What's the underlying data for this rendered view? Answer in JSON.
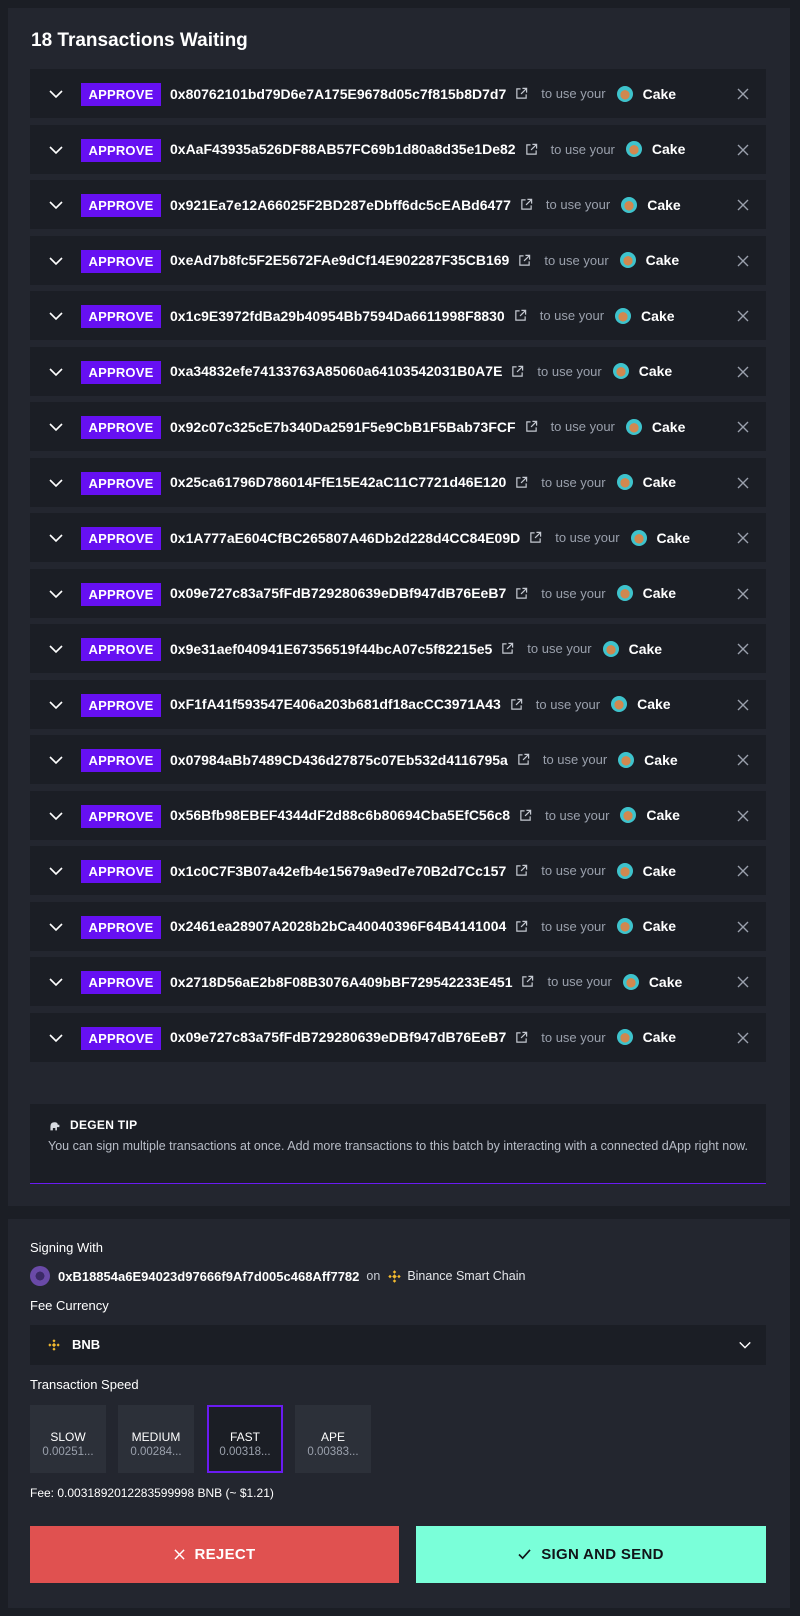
{
  "header": {
    "title": "18 Transactions Waiting"
  },
  "transactions": [
    {
      "action": "APPROVE",
      "address": "0x80762101bd79D6e7A175E9678d05c7f815b8D7d7",
      "use_text": "to use your",
      "token": "Cake"
    },
    {
      "action": "APPROVE",
      "address": "0xAaF43935a526DF88AB57FC69b1d80a8d35e1De82",
      "use_text": "to use your",
      "token": "Cake"
    },
    {
      "action": "APPROVE",
      "address": "0x921Ea7e12A66025F2BD287eDbff6dc5cEABd6477",
      "use_text": "to use your",
      "token": "Cake"
    },
    {
      "action": "APPROVE",
      "address": "0xeAd7b8fc5F2E5672FAe9dCf14E902287F35CB169",
      "use_text": "to use your",
      "token": "Cake"
    },
    {
      "action": "APPROVE",
      "address": "0x1c9E3972fdBa29b40954Bb7594Da6611998F8830",
      "use_text": "to use your",
      "token": "Cake"
    },
    {
      "action": "APPROVE",
      "address": "0xa34832efe74133763A85060a64103542031B0A7E",
      "use_text": "to use your",
      "token": "Cake"
    },
    {
      "action": "APPROVE",
      "address": "0x92c07c325cE7b340Da2591F5e9CbB1F5Bab73FCF",
      "use_text": "to use your",
      "token": "Cake"
    },
    {
      "action": "APPROVE",
      "address": "0x25ca61796D786014FfE15E42aC11C7721d46E120",
      "use_text": "to use your",
      "token": "Cake"
    },
    {
      "action": "APPROVE",
      "address": "0x1A777aE604CfBC265807A46Db2d228d4CC84E09D",
      "use_text": "to use your",
      "token": "Cake"
    },
    {
      "action": "APPROVE",
      "address": "0x09e727c83a75fFdB729280639eDBf947dB76EeB7",
      "use_text": "to use your",
      "token": "Cake"
    },
    {
      "action": "APPROVE",
      "address": "0x9e31aef040941E67356519f44bcA07c5f82215e5",
      "use_text": "to use your",
      "token": "Cake"
    },
    {
      "action": "APPROVE",
      "address": "0xF1fA41f593547E406a203b681df18acCC3971A43",
      "use_text": "to use your",
      "token": "Cake"
    },
    {
      "action": "APPROVE",
      "address": "0x07984aBb7489CD436d27875c07Eb532d4116795a",
      "use_text": "to use your",
      "token": "Cake"
    },
    {
      "action": "APPROVE",
      "address": "0x56Bfb98EBEF4344dF2d88c6b80694Cba5EfC56c8",
      "use_text": "to use your",
      "token": "Cake"
    },
    {
      "action": "APPROVE",
      "address": "0x1c0C7F3B07a42efb4e15679a9ed7e70B2d7Cc157",
      "use_text": "to use your",
      "token": "Cake"
    },
    {
      "action": "APPROVE",
      "address": "0x2461ea28907A2028b2bCa40040396F64B4141004",
      "use_text": "to use your",
      "token": "Cake"
    },
    {
      "action": "APPROVE",
      "address": "0x2718D56aE2b8F08B3076A409bBF729542233E451",
      "use_text": "to use your",
      "token": "Cake"
    },
    {
      "action": "APPROVE",
      "address": "0x09e727c83a75fFdB729280639eDBf947dB76EeB7",
      "use_text": "to use your",
      "token": "Cake"
    }
  ],
  "tip": {
    "icon": "gorilla-icon",
    "title": "DEGEN TIP",
    "body": "You can sign multiple transactions at once. Add more transactions to this batch by interacting with a connected dApp right now."
  },
  "signing": {
    "label": "Signing With",
    "address": "0xB18854a6E94023d97666f9Af7d005c468Aff7782",
    "on_text": "on",
    "chain": "Binance Smart Chain"
  },
  "fee_currency": {
    "label": "Fee Currency",
    "selected": "BNB"
  },
  "speed": {
    "label": "Transaction Speed",
    "options": [
      {
        "name": "SLOW",
        "value": "0.00251..."
      },
      {
        "name": "MEDIUM",
        "value": "0.00284..."
      },
      {
        "name": "FAST",
        "value": "0.00318..."
      },
      {
        "name": "APE",
        "value": "0.00383..."
      }
    ],
    "selected": "FAST"
  },
  "fee": {
    "text": "Fee: 0.0031892012283599998 BNB (~ $1.21)"
  },
  "buttons": {
    "reject": "REJECT",
    "sign": "SIGN AND SEND"
  },
  "colors": {
    "accent": "#6610f2",
    "reject": "#e05150",
    "sign": "#7affd9",
    "bnb": "#f3ba2f"
  }
}
